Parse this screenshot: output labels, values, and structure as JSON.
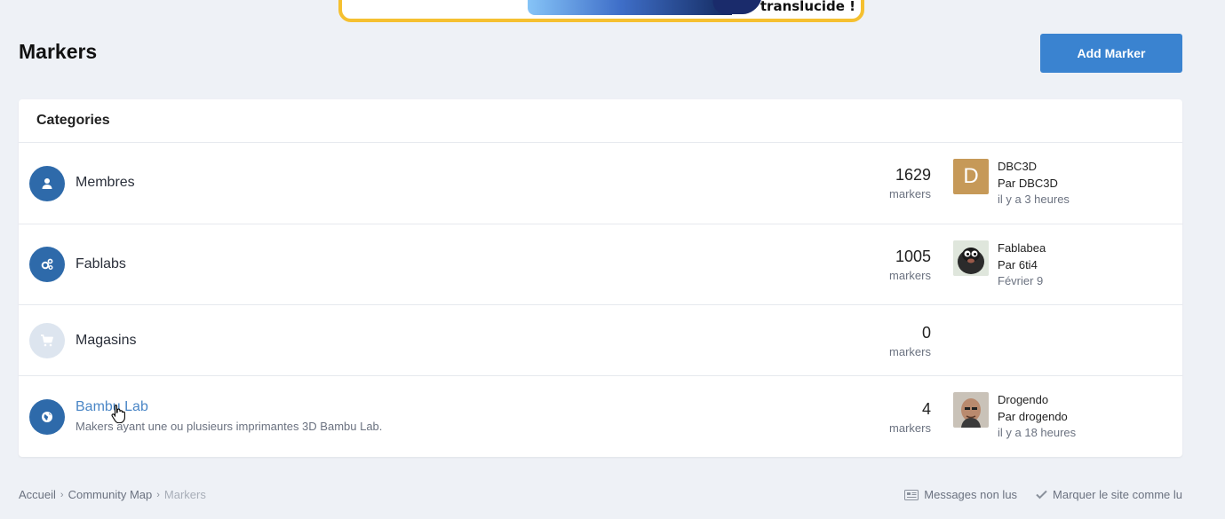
{
  "banner": {
    "text": "translucide !"
  },
  "header": {
    "title": "Markers",
    "add_button": "Add Marker"
  },
  "panel": {
    "title": "Categories"
  },
  "categories": [
    {
      "icon": "user-icon",
      "title": "Membres",
      "count": "1629",
      "count_label": "markers",
      "last": {
        "avatar_letter": "D",
        "name": "DBC3D",
        "by": "Par DBC3D",
        "time": "il y a 3 heures"
      }
    },
    {
      "icon": "gears-icon",
      "title": "Fablabs",
      "count": "1005",
      "count_label": "markers",
      "last": {
        "name": "Fablabea",
        "by": "Par 6ti4",
        "time": "Février 9"
      }
    },
    {
      "icon": "cart-icon",
      "title": "Magasins",
      "count": "0",
      "count_label": "markers"
    },
    {
      "icon": "globe-icon",
      "title": "Bambu Lab",
      "description": "Makers ayant une ou plusieurs imprimantes 3D Bambu Lab.",
      "count": "4",
      "count_label": "markers",
      "last": {
        "name": "Drogendo",
        "by": "Par drogendo",
        "time": "il y a 18 heures"
      }
    }
  ],
  "breadcrumb": [
    "Accueil",
    "Community Map",
    "Markers"
  ],
  "footer_links": {
    "unread": "Messages non lus",
    "mark_read": "Marquer le site comme lu"
  },
  "colors": {
    "accent": "#3a83d0",
    "icon_bg": "#2e6aaa",
    "page_bg": "#eef1f6"
  }
}
